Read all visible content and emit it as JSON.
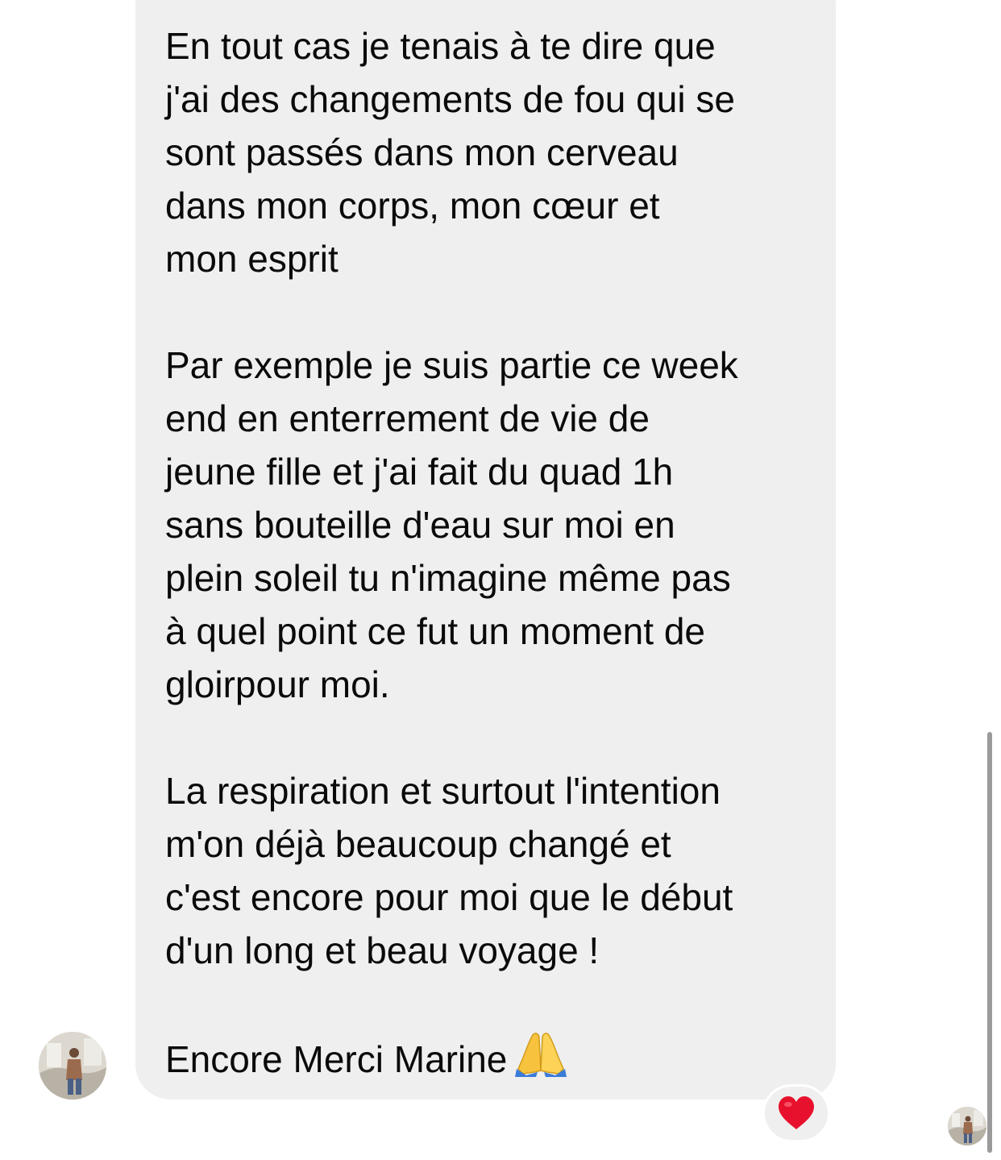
{
  "message": {
    "paragraphs": [
      "En tout cas je tenais à te dire que\nj'ai des changements de fou qui se\nsont passés dans mon cerveau\ndans mon corps, mon cœur et\nmon esprit",
      "Par exemple je suis partie ce week\nend en enterrement de vie de\njeune fille et j'ai fait du quad 1h\nsans bouteille d'eau sur moi en\nplein soleil tu n'imagine même pas\nà quel point ce fut un moment de\ngloirpour moi.",
      "La respiration et surtout l'intention\nm'on déjà beaucoup changé et\nc'est encore pour moi que le début\nd'un long et beau voyage !",
      "Encore Merci Marine"
    ],
    "closing_emoji": "folded-hands-icon",
    "bubble_color": "#efefef",
    "text_color": "#0a0a0a"
  },
  "reaction": {
    "icon": "red-heart-icon",
    "color": "#e8112d"
  },
  "sender_avatar": {
    "icon": "avatar-photo"
  },
  "read_receipt_avatar": {
    "icon": "avatar-photo"
  }
}
